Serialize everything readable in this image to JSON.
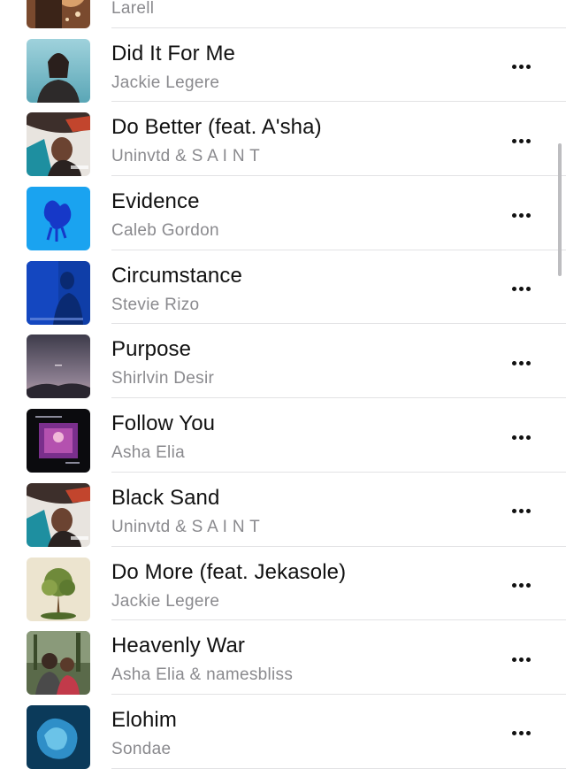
{
  "tracks": [
    {
      "title": "",
      "artist": "Larell",
      "art": "art-1"
    },
    {
      "title": "Did It For Me",
      "artist": "Jackie Legere",
      "art": "art-2"
    },
    {
      "title": "Do Better (feat. A'sha)",
      "artist": "Uninvtd & S A I N T",
      "art": "art-3"
    },
    {
      "title": "Evidence",
      "artist": "Caleb Gordon",
      "art": "art-4"
    },
    {
      "title": "Circumstance",
      "artist": "Stevie Rizo",
      "art": "art-5"
    },
    {
      "title": "Purpose",
      "artist": "Shirlvin Desir",
      "art": "art-6"
    },
    {
      "title": "Follow You",
      "artist": "Asha Elia",
      "art": "art-7"
    },
    {
      "title": "Black Sand",
      "artist": "Uninvtd & S A I N T",
      "art": "art-3"
    },
    {
      "title": "Do More (feat. Jekasole)",
      "artist": "Jackie Legere",
      "art": "art-8"
    },
    {
      "title": "Heavenly War",
      "artist": "Asha Elia & namesbliss",
      "art": "art-9"
    },
    {
      "title": "Elohim",
      "artist": "Sondae",
      "art": "art-10"
    }
  ],
  "icons": {
    "more": "ellipsis-icon"
  }
}
